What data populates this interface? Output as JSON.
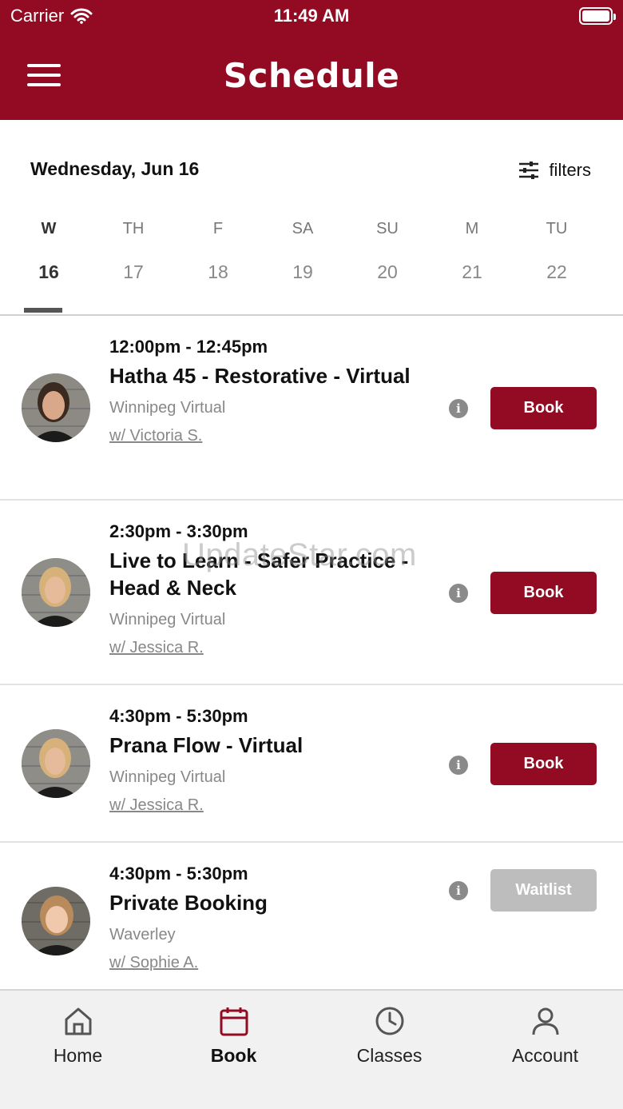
{
  "status_bar": {
    "carrier": "Carrier",
    "time": "11:49 AM"
  },
  "header": {
    "title": "Schedule"
  },
  "schedule": {
    "current_date": "Wednesday, Jun 16",
    "filters_label": "filters",
    "days": [
      {
        "dow": "W",
        "num": "16"
      },
      {
        "dow": "TH",
        "num": "17"
      },
      {
        "dow": "F",
        "num": "18"
      },
      {
        "dow": "SA",
        "num": "19"
      },
      {
        "dow": "SU",
        "num": "20"
      },
      {
        "dow": "M",
        "num": "21"
      },
      {
        "dow": "TU",
        "num": "22"
      }
    ]
  },
  "classes": [
    {
      "time": "12:00pm - 12:45pm",
      "name": "Hatha 45 - Restorative - Virtual",
      "location": "Winnipeg Virtual",
      "instructor": "w/ Victoria S.",
      "action": "Book"
    },
    {
      "time": "2:30pm - 3:30pm",
      "name": "Live to Learn - Safer Practice - Head & Neck",
      "location": "Winnipeg Virtual",
      "instructor": "w/ Jessica R.",
      "action": "Book"
    },
    {
      "time": "4:30pm - 5:30pm",
      "name": "Prana Flow - Virtual",
      "location": "Winnipeg Virtual",
      "instructor": "w/ Jessica R.",
      "action": "Book"
    },
    {
      "time": "4:30pm - 5:30pm",
      "name": "Private Booking",
      "location": "Waverley",
      "instructor": "w/ Sophie A.",
      "action": "Waitlist"
    }
  ],
  "watermark": "UpdateStar.com",
  "tabs": [
    {
      "label": "Home",
      "icon": "home-icon"
    },
    {
      "label": "Book",
      "icon": "calendar-icon"
    },
    {
      "label": "Classes",
      "icon": "clock-icon"
    },
    {
      "label": "Account",
      "icon": "user-icon"
    }
  ],
  "colors": {
    "brand": "#930b22",
    "waitlist": "#bdbdbd",
    "tabbar_bg": "#f1f1f1"
  }
}
